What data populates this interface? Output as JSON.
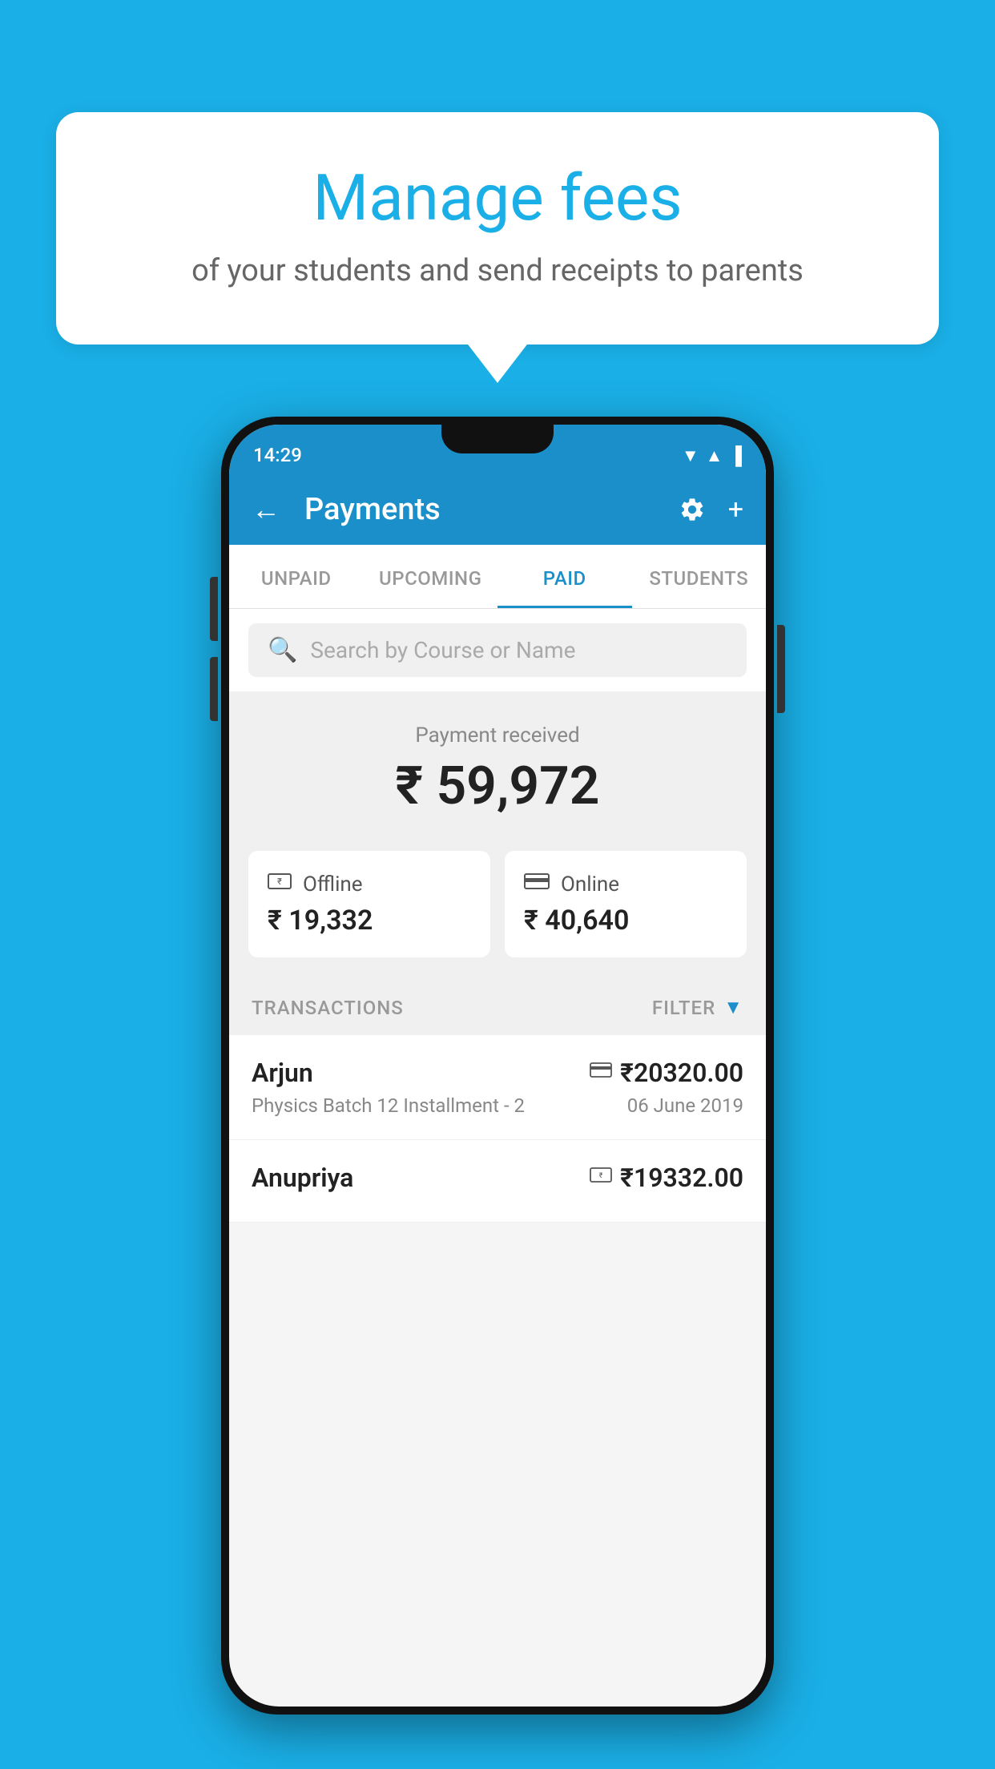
{
  "background_color": "#1AAFE6",
  "speech_bubble": {
    "title": "Manage fees",
    "subtitle": "of your students and send receipts to parents"
  },
  "phone": {
    "status_bar": {
      "time": "14:29",
      "wifi_icon": "wifi",
      "signal_icon": "signal",
      "battery_icon": "battery"
    },
    "header": {
      "back_label": "←",
      "title": "Payments",
      "gear_label": "⚙",
      "plus_label": "+"
    },
    "tabs": [
      {
        "label": "UNPAID",
        "active": false
      },
      {
        "label": "UPCOMING",
        "active": false
      },
      {
        "label": "PAID",
        "active": true
      },
      {
        "label": "STUDENTS",
        "active": false
      }
    ],
    "search": {
      "placeholder": "Search by Course or Name"
    },
    "payment_received": {
      "label": "Payment received",
      "amount": "₹ 59,972"
    },
    "cards": [
      {
        "type": "Offline",
        "amount": "₹ 19,332",
        "icon": "offline"
      },
      {
        "type": "Online",
        "amount": "₹ 40,640",
        "icon": "online"
      }
    ],
    "transactions_header": {
      "label": "TRANSACTIONS",
      "filter_label": "FILTER"
    },
    "transactions": [
      {
        "name": "Arjun",
        "course": "Physics Batch 12 Installment - 2",
        "amount": "₹20320.00",
        "date": "06 June 2019",
        "payment_type": "online"
      },
      {
        "name": "Anupriya",
        "course": "",
        "amount": "₹19332.00",
        "date": "",
        "payment_type": "offline"
      }
    ]
  }
}
